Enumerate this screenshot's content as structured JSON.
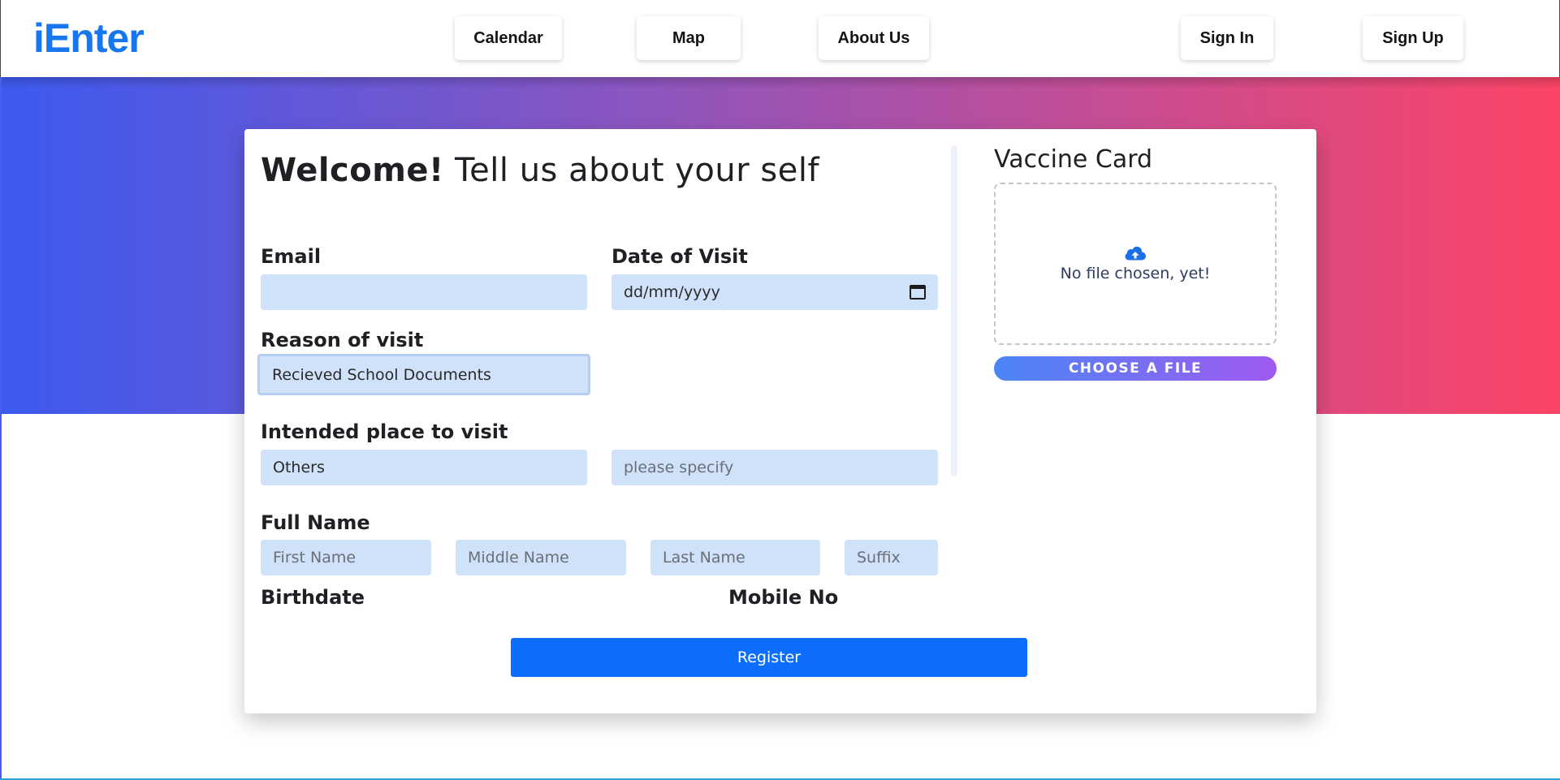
{
  "brand": "iEnter",
  "nav": {
    "calendar": "Calendar",
    "map": "Map",
    "about": "About Us",
    "sign_in": "Sign In",
    "sign_up": "Sign Up"
  },
  "form": {
    "welcome_bold": "Welcome!",
    "welcome_rest": "Tell us about your self",
    "email_label": "Email",
    "email_value": "",
    "date_label": "Date of Visit",
    "date_placeholder": "dd/mm/yyyy",
    "reason_label": "Reason of visit",
    "reason_value": "Recieved School Documents",
    "place_label": "Intended place to visit",
    "place_value": "Others",
    "place_specify_placeholder": "please specify",
    "fullname_label": "Full Name",
    "first_name_placeholder": "First Name",
    "middle_name_placeholder": "Middle Name",
    "last_name_placeholder": "Last Name",
    "suffix_placeholder": "Suffix",
    "birthdate_label": "Birthdate",
    "mobile_label": "Mobile No",
    "register_label": "Register"
  },
  "vaccine": {
    "title": "Vaccine Card",
    "status": "No file chosen, yet!",
    "choose_label": "CHOOSE A FILE"
  },
  "colors": {
    "brand": "#1877ee",
    "field_bg": "#cfe2fa",
    "register_bg": "#0d6efd",
    "gradient_start": "#3c5af0",
    "gradient_end": "#fc4466"
  }
}
